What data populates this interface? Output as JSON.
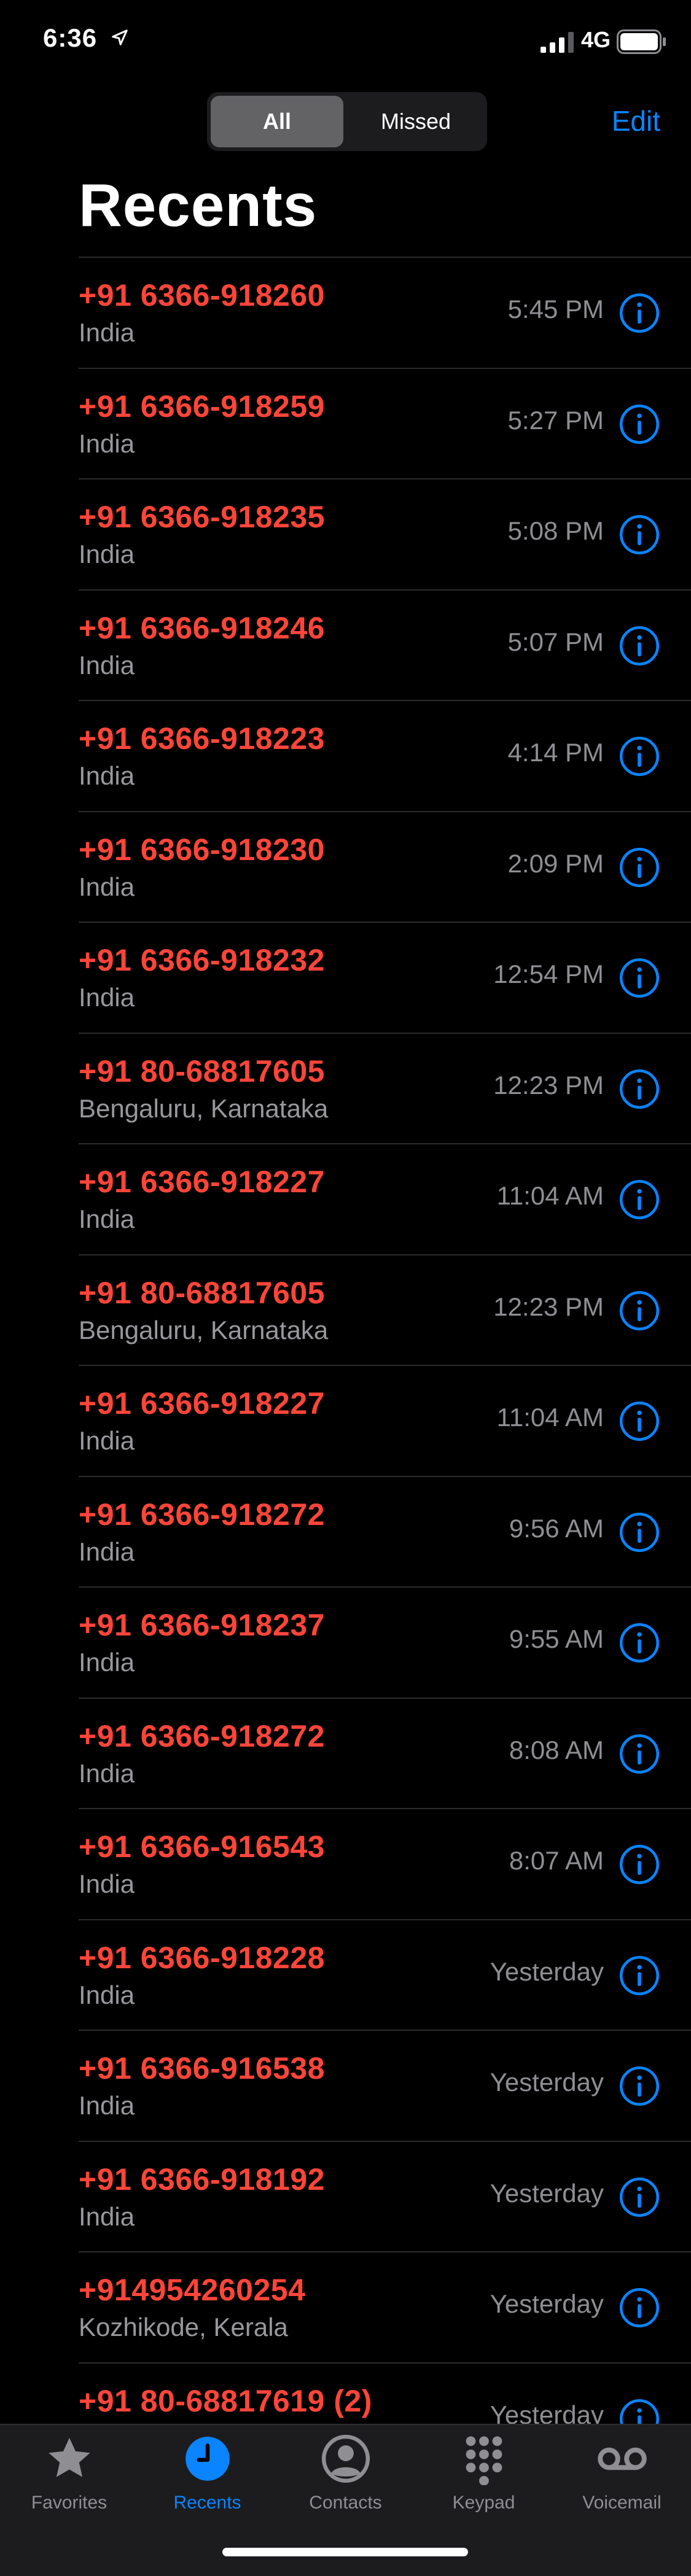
{
  "status_bar": {
    "time": "6:36",
    "network": "4G"
  },
  "segmented": {
    "all": "All",
    "missed": "Missed"
  },
  "edit_label": "Edit",
  "title": "Recents",
  "calls": [
    {
      "number": "+91 6366-918260",
      "location": "India",
      "time": "5:45 PM"
    },
    {
      "number": "+91 6366-918259",
      "location": "India",
      "time": "5:27 PM"
    },
    {
      "number": "+91 6366-918235",
      "location": "India",
      "time": "5:08 PM"
    },
    {
      "number": "+91 6366-918246",
      "location": "India",
      "time": "5:07 PM"
    },
    {
      "number": "+91 6366-918223",
      "location": "India",
      "time": "4:14 PM"
    },
    {
      "number": "+91 6366-918230",
      "location": "India",
      "time": "2:09 PM"
    },
    {
      "number": "+91 6366-918232",
      "location": "India",
      "time": "12:54 PM"
    },
    {
      "number": "+91 80-68817605",
      "location": "Bengaluru, Karnataka",
      "time": "12:23 PM"
    },
    {
      "number": "+91 6366-918227",
      "location": "India",
      "time": "11:04 AM"
    },
    {
      "number": "+91 80-68817605",
      "location": "Bengaluru, Karnataka",
      "time": "12:23 PM"
    },
    {
      "number": "+91 6366-918227",
      "location": "India",
      "time": "11:04 AM"
    },
    {
      "number": "+91 6366-918272",
      "location": "India",
      "time": "9:56 AM"
    },
    {
      "number": "+91 6366-918237",
      "location": "India",
      "time": "9:55 AM"
    },
    {
      "number": "+91 6366-918272",
      "location": "India",
      "time": "8:08 AM"
    },
    {
      "number": "+91 6366-916543",
      "location": "India",
      "time": "8:07 AM"
    },
    {
      "number": "+91 6366-918228",
      "location": "India",
      "time": "Yesterday"
    },
    {
      "number": "+91 6366-916538",
      "location": "India",
      "time": "Yesterday"
    },
    {
      "number": "+91 6366-918192",
      "location": "India",
      "time": "Yesterday"
    },
    {
      "number": "+914954260254",
      "location": "Kozhikode, Kerala",
      "time": "Yesterday"
    },
    {
      "number": "+91 80-68817619 (2)",
      "location": "",
      "time": "Yesterday"
    }
  ],
  "tabs": [
    {
      "label": "Favorites",
      "icon": "star-icon"
    },
    {
      "label": "Recents",
      "icon": "clock-icon"
    },
    {
      "label": "Contacts",
      "icon": "person-circle-icon"
    },
    {
      "label": "Keypad",
      "icon": "keypad-icon"
    },
    {
      "label": "Voicemail",
      "icon": "voicemail-icon"
    }
  ],
  "colors": {
    "accent": "#0a84ff",
    "missed": "#ff453a",
    "secondary": "#8e8e93"
  }
}
